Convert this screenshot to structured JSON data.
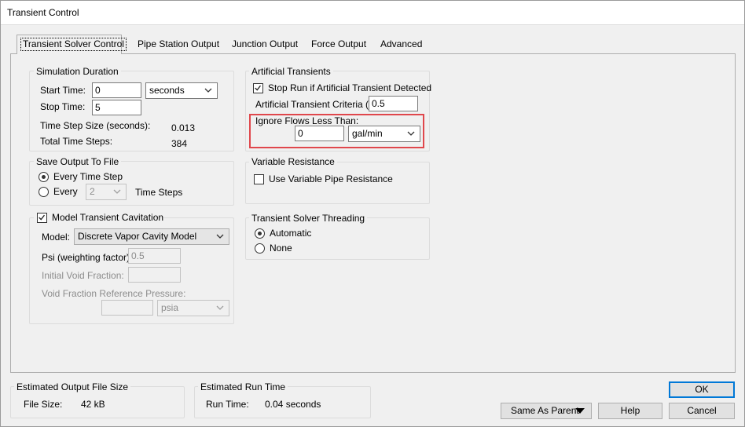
{
  "window": {
    "title": "Transient Control"
  },
  "tabs": [
    {
      "label": "Transient Solver Control",
      "active": true
    },
    {
      "label": "Pipe Station Output"
    },
    {
      "label": "Junction Output"
    },
    {
      "label": "Force Output"
    },
    {
      "label": "Advanced"
    }
  ],
  "simulation_duration": {
    "title": "Simulation Duration",
    "start_time_label": "Start Time:",
    "start_time_value": "0",
    "time_unit": "seconds",
    "stop_time_label": "Stop Time:",
    "stop_time_value": "5",
    "time_step_label": "Time Step Size (seconds):",
    "time_step_value": "0.013",
    "total_steps_label": "Total Time Steps:",
    "total_steps_value": "384"
  },
  "save_output": {
    "title": "Save Output To File",
    "every_time_step_label": "Every Time Step",
    "every_label": "Every",
    "every_value": "2",
    "time_steps_label": "Time Steps"
  },
  "cavitation": {
    "title": "Model Transient Cavitation",
    "model_label": "Model:",
    "model_value": "Discrete Vapor Cavity Model",
    "psi_label": "Psi (weighting factor):",
    "psi_value": "0.5",
    "void_fraction_label": "Initial Void Fraction:",
    "void_fraction_value": "",
    "ref_pressure_label": "Void Fraction Reference Pressure:",
    "ref_pressure_value": "",
    "ref_pressure_unit": "psia"
  },
  "artificial_transients": {
    "title": "Artificial Transients",
    "stop_run_label": "Stop Run if Artificial Transient Detected",
    "criteria_label": "Artificial Transient Criteria (%):",
    "criteria_value": "0.5",
    "ignore_flows_label": "Ignore Flows Less Than:",
    "ignore_flows_value": "0",
    "ignore_flows_unit": "gal/min"
  },
  "variable_resistance": {
    "title": "Variable Resistance",
    "use_label": "Use Variable Pipe Resistance"
  },
  "threading": {
    "title": "Transient Solver Threading",
    "automatic_label": "Automatic",
    "none_label": "None"
  },
  "output_file_size": {
    "title": "Estimated Output File Size",
    "label": "File Size:",
    "value": "42 kB"
  },
  "run_time": {
    "title": "Estimated Run Time",
    "label": "Run Time:",
    "value": "0.04 seconds"
  },
  "buttons": {
    "ok": "OK",
    "same_as_parent": "Same As Parent",
    "help": "Help",
    "cancel": "Cancel"
  },
  "colors": {
    "highlight": "#e0474c",
    "default_button_border": "#0078d7"
  }
}
